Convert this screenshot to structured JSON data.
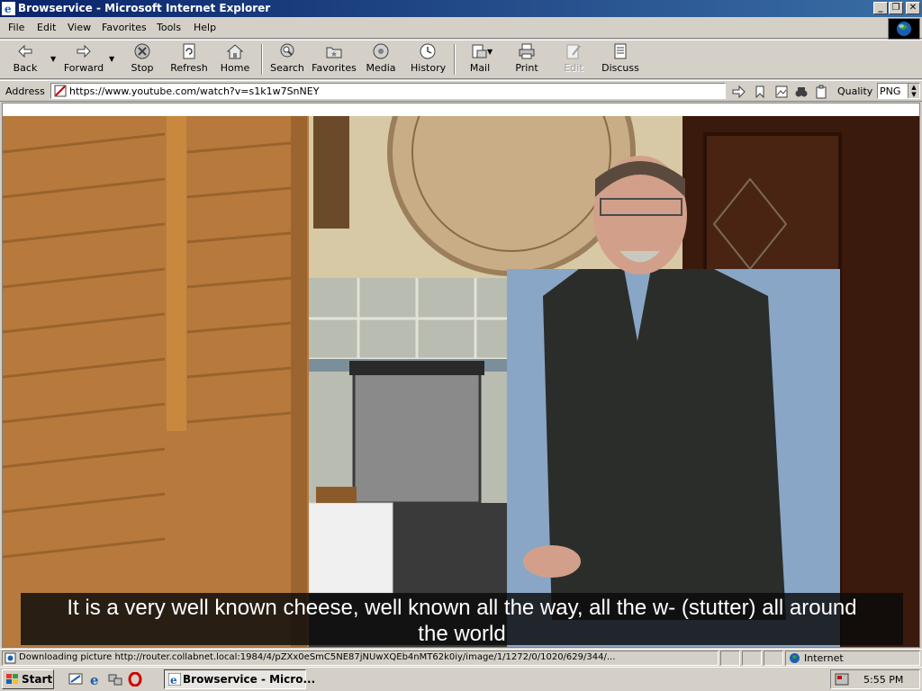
{
  "window": {
    "title": "Browservice - Microsoft Internet Explorer"
  },
  "menu": [
    "File",
    "Edit",
    "View",
    "Favorites",
    "Tools",
    "Help"
  ],
  "toolbar": {
    "back": "Back",
    "forward": "Forward",
    "stop": "Stop",
    "refresh": "Refresh",
    "home": "Home",
    "search": "Search",
    "favorites": "Favorites",
    "media": "Media",
    "history": "History",
    "mail": "Mail",
    "print": "Print",
    "edit": "Edit",
    "discuss": "Discuss"
  },
  "address": {
    "label": "Address",
    "url": "https://www.youtube.com/watch?v=s1k1w7SnNEY",
    "quality_label": "Quality",
    "quality_value": "PNG"
  },
  "video": {
    "subtitle_line1": "It is a very well known cheese, well known all the way, all the w- (stutter) all around",
    "subtitle_line2": "the world"
  },
  "status": {
    "text": "Downloading picture http://router.collabnet.local:1984/4/pZXx0eSmC5NE87jNUwXQEb4nMT62k0iy/image/1/1272/0/1020/629/344/...",
    "zone": "Internet"
  },
  "taskbar": {
    "start": "Start",
    "task": "Browservice - Micro...",
    "clock": "5:55 PM"
  },
  "colors": {
    "titlebar_start": "#0a246a",
    "titlebar_end": "#3a6ea5",
    "chrome": "#d4d0c8"
  }
}
